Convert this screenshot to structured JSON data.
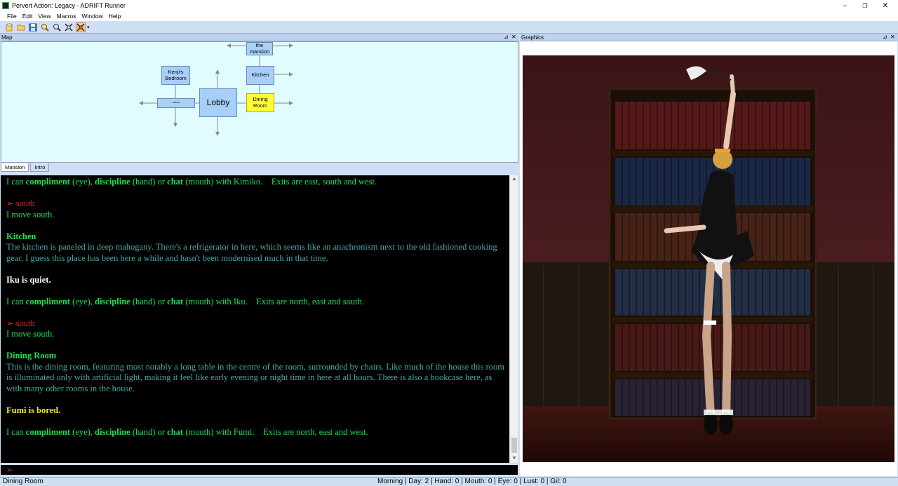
{
  "window": {
    "title": "Pervert Action: Legacy - ADRIFT Runner",
    "min_glyph": "–",
    "max_glyph": "❐",
    "close_glyph": "✕"
  },
  "menu": [
    "File",
    "Edit",
    "View",
    "Macros",
    "Window",
    "Help"
  ],
  "panels": {
    "map_title": "Map",
    "graphics_title": "Graphics",
    "pin_glyph": "⊿",
    "close_glyph": "✕"
  },
  "map": {
    "rooms": {
      "mansion": "the\nmansion",
      "kenji": "Kenji's\nBedroom",
      "kitchen": "Kitchen",
      "hallway": "Hallway",
      "lobby": "Lobby",
      "dining": "Dining\nRoom"
    },
    "tabs": [
      "Mansion",
      "Intro"
    ]
  },
  "output": {
    "l1a": "I can ",
    "l1b": "compliment",
    "l1c": " (eye), ",
    "l1d": "discipline",
    "l1e": " (hand) or ",
    "l1f": "chat",
    "l1g": " (mouth) with Kimiko.    Exits are east, south and west.",
    "cmd1": "➢ south",
    "move1": "I move south.",
    "kitchen_title": "Kitchen",
    "kitchen_desc": "The kitchen is paneled in deep mahogany. There's a refrigerator in here, which seems like an anachronism next to the old fashioned cooking gear. I guess this place has been here a while and hasn't been modernised much in that time.",
    "iku_quiet": "Iku is quiet.",
    "l2a": "I can ",
    "l2b": "compliment",
    "l2c": " (eye), ",
    "l2d": "discipline",
    "l2e": " (hand) or ",
    "l2f": "chat",
    "l2g": " (mouth) with Iku.    Exits are north, east and south.",
    "cmd2": "➢ south",
    "move2": "I move south.",
    "dining_title": "Dining Room",
    "dining_desc": "This is the dining room, featuring most notably a long table in the centre of the room, surrounded by chairs. Like much of the house this room is illuminated only with artificial light, making it feel like early evening or night time in here at all hours. There is also a bookcase here, as with many other rooms in the house.",
    "fumi_bored": "Fumi is bored.",
    "l3a": "I can ",
    "l3b": "compliment",
    "l3c": " (eye), ",
    "l3d": "discipline",
    "l3e": " (hand) or ",
    "l3f": "chat",
    "l3g": " (mouth) with Fumi.    Exits are north, east and west.",
    "prompt": "➢"
  },
  "status": {
    "location": "Dining Room",
    "stats": "Morning | Day: 2 | Hand: 0 | Mouth: 0 | Eye: 0 | Lust: 0 | Gil: 0"
  },
  "colors": {
    "accent": "#cfe0f4",
    "room": "#a8cff8",
    "current_room": "#ffff33",
    "text_green": "#22dd55",
    "text_teal": "#4aa6a6",
    "text_red": "#e0251f"
  },
  "icons": [
    "new-file-icon",
    "open-folder-icon",
    "save-icon",
    "search-icon",
    "zoom-icon",
    "fit-icon",
    "map-icon"
  ]
}
